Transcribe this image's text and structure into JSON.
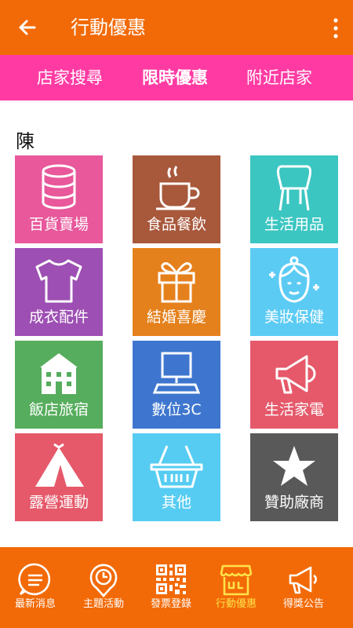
{
  "header": {
    "title": "行動優惠"
  },
  "subtabs": [
    {
      "label": "店家搜尋"
    },
    {
      "label": "限時優惠"
    },
    {
      "label": "附近店家"
    }
  ],
  "section": {
    "title": "陳"
  },
  "categories": [
    {
      "label": "百貨賣場",
      "icon": "database-icon",
      "color": "#e8589b"
    },
    {
      "label": "食品餐飲",
      "icon": "coffee-cup-icon",
      "color": "#a8583b"
    },
    {
      "label": "生活用品",
      "icon": "chair-icon",
      "color": "#3cc6c2"
    },
    {
      "label": "成衣配件",
      "icon": "tshirt-icon",
      "color": "#9d4fb3"
    },
    {
      "label": "結婚喜慶",
      "icon": "gift-icon",
      "color": "#e5811c"
    },
    {
      "label": "美妝保健",
      "icon": "face-icon",
      "color": "#5ccbf4"
    },
    {
      "label": "飯店旅宿",
      "icon": "hotel-icon",
      "color": "#56ad5d"
    },
    {
      "label": "數位3C",
      "icon": "computer-icon",
      "color": "#3e76cf"
    },
    {
      "label": "生活家電",
      "icon": "megaphone-icon",
      "color": "#e5596a"
    },
    {
      "label": "露營運動",
      "icon": "tent-icon",
      "color": "#e5596a"
    },
    {
      "label": "其他",
      "icon": "basket-icon",
      "color": "#56ccf2"
    },
    {
      "label": "贊助廠商",
      "icon": "star-icon",
      "color": "#595959"
    }
  ],
  "bottom_nav": [
    {
      "label": "最新消息",
      "icon": "message-icon"
    },
    {
      "label": "主題活動",
      "icon": "clock-pin-icon"
    },
    {
      "label": "發票登錄",
      "icon": "qrcode-icon"
    },
    {
      "label": "行動優惠",
      "icon": "shop-icon"
    },
    {
      "label": "得獎公告",
      "icon": "megaphone-icon"
    }
  ],
  "colors": {
    "topbar": "#f26a07",
    "subtabs": "#ff3ba3",
    "active_nav": "#ffe24a"
  }
}
